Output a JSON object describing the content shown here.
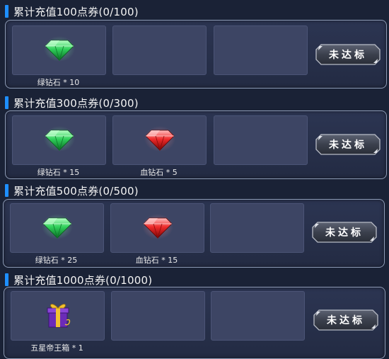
{
  "colors": {
    "accent": "#1e8fff",
    "panel_border": "#8d9bb6",
    "slot_bg": "#3d4564"
  },
  "tiers": [
    {
      "title": "累计充值100点券(0/100)",
      "button_label": "未达标",
      "items": [
        {
          "icon": "green-diamond-icon",
          "label": "绿钻石 * 10"
        }
      ]
    },
    {
      "title": "累计充值300点券(0/300)",
      "button_label": "未达标",
      "items": [
        {
          "icon": "green-diamond-icon",
          "label": "绿钻石 * 15"
        },
        {
          "icon": "red-diamond-icon",
          "label": "血钻石 * 5"
        }
      ]
    },
    {
      "title": "累计充值500点券(0/500)",
      "button_label": "未达标",
      "items": [
        {
          "icon": "green-diamond-icon",
          "label": "绿钻石 * 25"
        },
        {
          "icon": "red-diamond-icon",
          "label": "血钻石 * 15"
        }
      ]
    },
    {
      "title": "累计充值1000点券(0/1000)",
      "button_label": "未达标",
      "items": [
        {
          "icon": "purple-gift-box-icon",
          "label": "五星帝王箱 * 1"
        }
      ]
    }
  ]
}
